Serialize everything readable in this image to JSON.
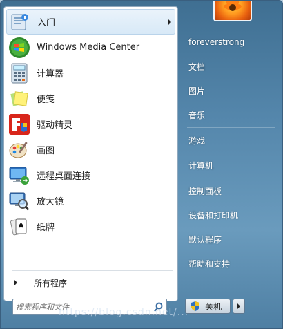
{
  "programs": [
    {
      "label": "入门",
      "icon": "getting-started-icon",
      "has_submenu": true
    },
    {
      "label": "Windows Media Center",
      "icon": "windows-media-center-icon"
    },
    {
      "label": "计算器",
      "icon": "calculator-icon"
    },
    {
      "label": "便笺",
      "icon": "sticky-notes-icon"
    },
    {
      "label": "驱动精灵",
      "icon": "driver-genius-icon"
    },
    {
      "label": "画图",
      "icon": "paint-icon"
    },
    {
      "label": "远程桌面连接",
      "icon": "remote-desktop-icon"
    },
    {
      "label": "放大镜",
      "icon": "magnifier-icon"
    },
    {
      "label": "纸牌",
      "icon": "solitaire-icon"
    }
  ],
  "all_programs_label": "所有程序",
  "search": {
    "placeholder": "搜索程序和文件"
  },
  "right_items": [
    {
      "label": "foreverstrong"
    },
    {
      "label": "文档"
    },
    {
      "label": "图片"
    },
    {
      "label": "音乐"
    },
    {
      "label": "游戏"
    },
    {
      "label": "计算机"
    },
    {
      "label": "控制面板"
    },
    {
      "label": "设备和打印机"
    },
    {
      "label": "默认程序"
    },
    {
      "label": "帮助和支持"
    }
  ],
  "shutdown_label": "关机",
  "watermark": "https://blog.csdn.net/...",
  "colors": {
    "accent": "#5486ab",
    "shield_blue": "#2f6fbf",
    "shield_yellow": "#f3c21b"
  }
}
